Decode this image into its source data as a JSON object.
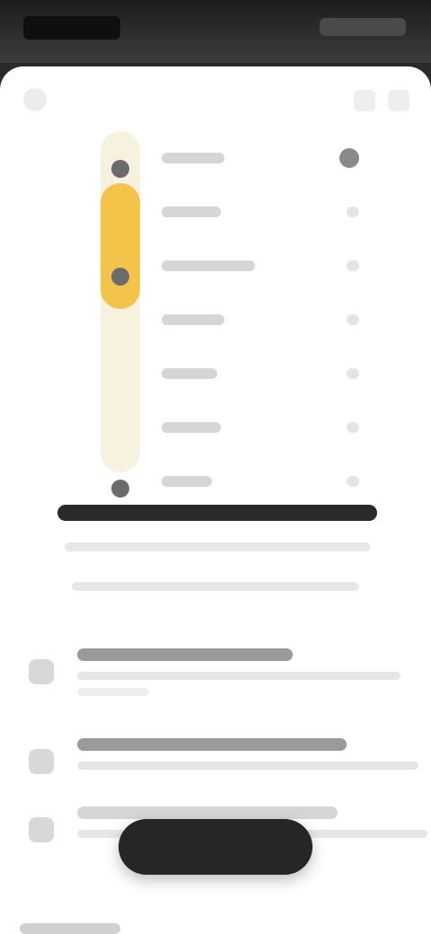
{
  "colors": {
    "accent": "#f4c34a",
    "track": "#f6f2df",
    "button": "#262626",
    "sheet": "#ffffff"
  },
  "icons": {
    "close": "close-icon",
    "share": "share-icon",
    "more": "more-icon"
  },
  "chart": {
    "rows": [
      {
        "label": ""
      },
      {
        "label": ""
      },
      {
        "label": ""
      },
      {
        "label": ""
      },
      {
        "label": ""
      },
      {
        "label": ""
      },
      {
        "label": ""
      }
    ]
  },
  "list": [
    {
      "title": "",
      "description": ""
    },
    {
      "title": "",
      "description": ""
    },
    {
      "title": "",
      "description": ""
    }
  ]
}
